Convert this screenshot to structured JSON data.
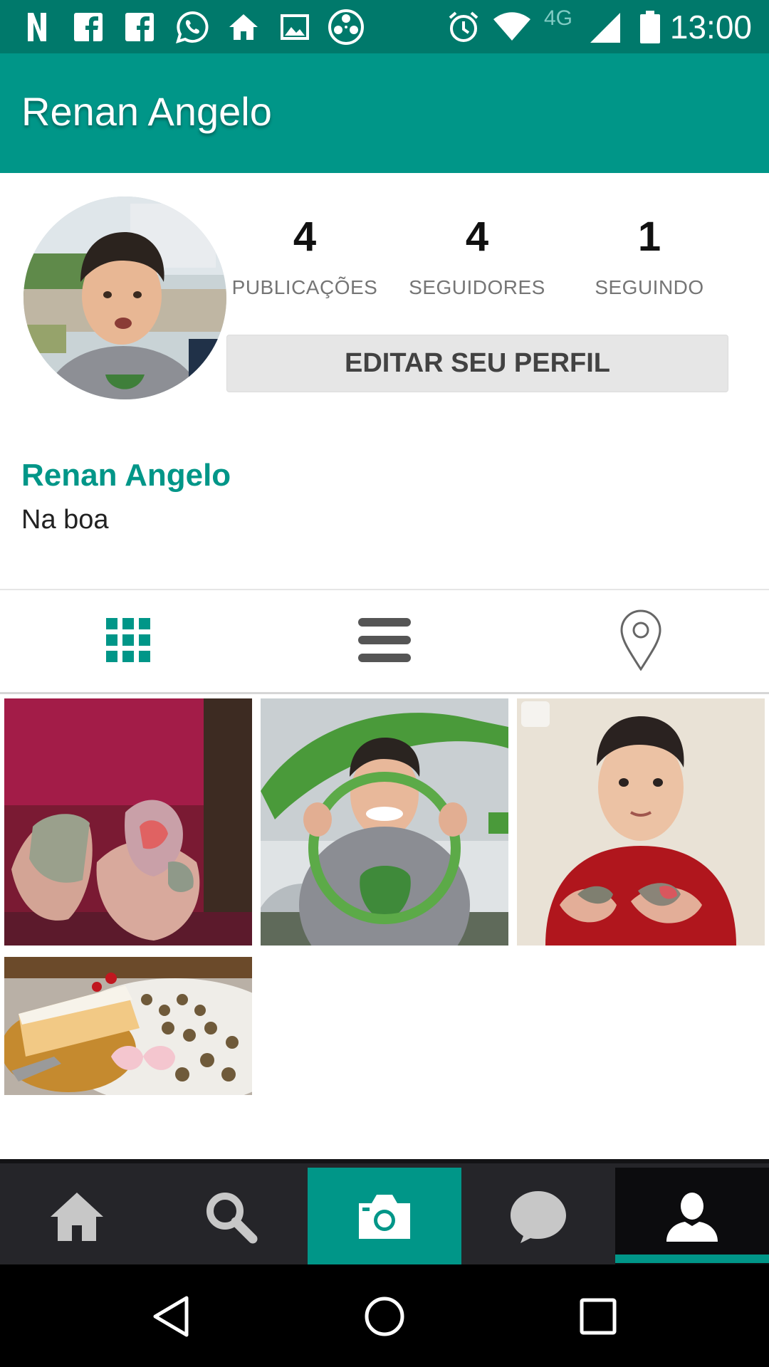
{
  "status_bar": {
    "time": "13:00",
    "network": "4G",
    "notification_icons": [
      "netflix-n-icon",
      "facebook-icon",
      "facebook-icon",
      "whatsapp-icon",
      "home-icon",
      "image-icon",
      "film-reel-icon"
    ],
    "system_icons": [
      "alarm-icon",
      "wifi-icon",
      "signal-icon",
      "battery-icon"
    ]
  },
  "app_bar": {
    "title": "Renan Angelo"
  },
  "profile": {
    "stats": [
      {
        "count": "4",
        "label": "PUBLICAÇÕES"
      },
      {
        "count": "4",
        "label": "SEGUIDORES"
      },
      {
        "count": "1",
        "label": "SEGUINDO"
      }
    ],
    "edit_button": "EDITAR SEU PERFIL",
    "name": "Renan Angelo",
    "bio": "Na boa"
  },
  "view_tabs": [
    {
      "icon": "grid-icon",
      "active": true
    },
    {
      "icon": "list-icon",
      "active": false
    },
    {
      "icon": "location-pin-icon",
      "active": false
    }
  ],
  "photos": [
    {
      "subject": "hands-holding-clay"
    },
    {
      "subject": "boy-in-playground-ring"
    },
    {
      "subject": "boy-in-red-shirt-with-clay"
    },
    {
      "subject": "birthday-cake-and-sweets"
    }
  ],
  "bottom_nav": [
    {
      "icon": "home-icon"
    },
    {
      "icon": "search-icon"
    },
    {
      "icon": "camera-icon"
    },
    {
      "icon": "chat-bubble-icon"
    },
    {
      "icon": "person-icon",
      "active": true
    }
  ],
  "system_nav": [
    "back-icon",
    "home-circle-icon",
    "recents-icon"
  ],
  "colors": {
    "primary": "#009688",
    "primary_dark": "#00796b",
    "nav_bg": "#252529"
  }
}
